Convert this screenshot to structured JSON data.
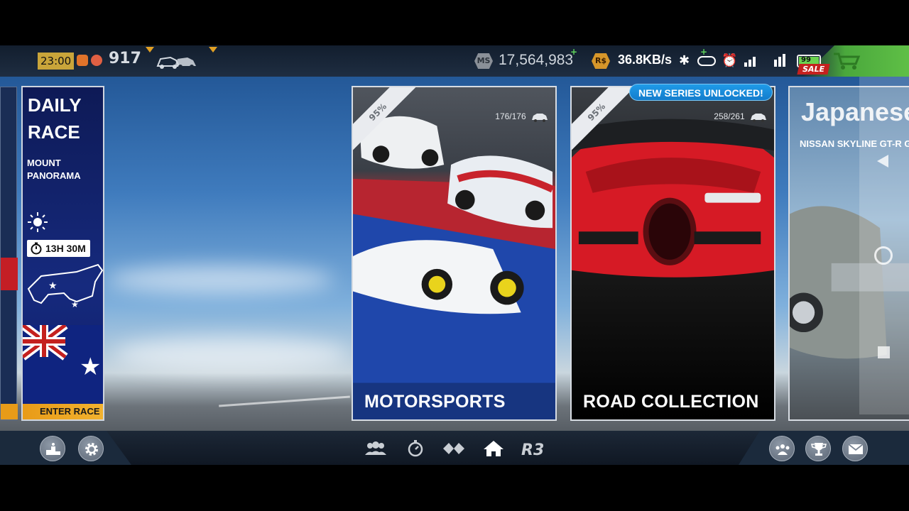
{
  "status_bar": {
    "time": "23:00",
    "car_count": "917",
    "network_speed": "36.8KB/s",
    "battery": "99"
  },
  "currency": {
    "ms_label": "MS",
    "ms_value": "17,564,983",
    "rs_label": "R$"
  },
  "store": {
    "sale_label": "SALE"
  },
  "daily_race": {
    "title": "DAILY RACE",
    "track": "MOUNT PANORAMA",
    "timer": "13H 30M",
    "cta": "ENTER RACE"
  },
  "series_cards": [
    {
      "title": "MOTORSPORTS",
      "progress": "95%",
      "count": "176/176"
    },
    {
      "title": "ROAD COLLECTION",
      "progress": "95%",
      "count": "258/261"
    },
    {
      "title": "Japanese",
      "subtitle": "NISSAN SKYLINE GT-R GI"
    }
  ],
  "banner": {
    "new_series": "NEW SERIES UNLOCKED!"
  },
  "bottom_nav": {
    "tabs": [
      "multiplayer-icon",
      "time-trial-icon",
      "events-icon",
      "home-icon",
      "r3-logo-icon"
    ],
    "left_buttons": [
      "podium-icon",
      "gear-icon"
    ],
    "right_buttons": [
      "team-icon",
      "trophy-icon",
      "mail-icon"
    ]
  },
  "colors": {
    "accent_orange": "#e89b18",
    "banner_blue": "#1f9be8",
    "sale_red": "#c4211f",
    "store_green": "#5fbf46"
  }
}
